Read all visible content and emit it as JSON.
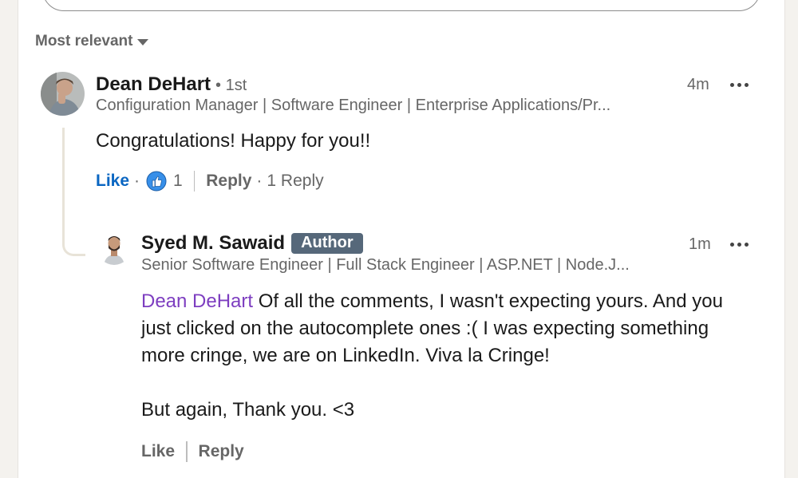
{
  "sort": {
    "label": "Most relevant"
  },
  "comments": [
    {
      "author": "Dean DeHart",
      "degree": "• 1st",
      "headline": "Configuration Manager | Software Engineer | Enterprise Applications/Pr...",
      "time": "4m",
      "text": "Congratulations! Happy for you!!",
      "actions": {
        "like": "Like",
        "dot": "·",
        "reaction_count": "1",
        "reply": "Reply",
        "dot2": "·",
        "replies": "1 Reply"
      }
    }
  ],
  "reply": {
    "author": "Syed M. Sawaid",
    "badge": "Author",
    "headline": "Senior Software Engineer | Full Stack Engineer | ASP.NET | Node.J...",
    "time": "1m",
    "mention": "Dean DeHart",
    "text_line1_rest": " Of all the comments, I wasn't expecting yours. And you",
    "text_line2": "just clicked on the autocomplete ones :( I was expecting something",
    "text_line3": "more cringe, we are on LinkedIn. Viva la Cringe!",
    "text_line4": "But again, Thank you. <3",
    "actions": {
      "like": "Like",
      "reply": "Reply"
    }
  },
  "colors": {
    "accent": "#0a66c2",
    "mention": "#7d3ec0",
    "badge": "#56687a",
    "muted": "#666666"
  },
  "icons": [
    "caret-down-icon",
    "more-options-icon",
    "thumbs-up-reaction-icon"
  ]
}
